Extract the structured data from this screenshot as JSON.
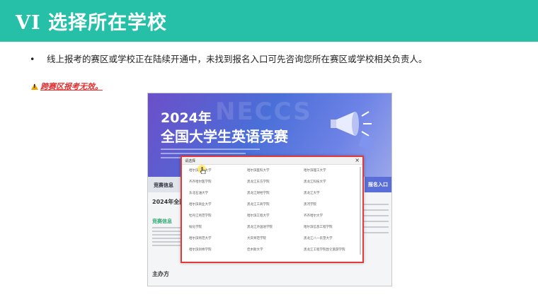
{
  "header": {
    "title": "VI 选择所在学校"
  },
  "bullet": {
    "dot": "•",
    "text": "线上报考的赛区或学校正在陆续开通中，未找到报名入口可先咨询您所在赛区或学校相关负责人。"
  },
  "warning": {
    "text": "跨赛区报考无效。"
  },
  "screenshot": {
    "watermark": "NECCS",
    "year": "2024年",
    "contest_name": "全国大学生英语竞赛",
    "nav_left": "竞赛信息",
    "nav_right": "报名入口",
    "section_title": "2024年全国",
    "section_info": "竞赛信息",
    "section_org": "主办方",
    "dialog": {
      "title": "请选择",
      "close": "×",
      "rows": [
        [
          "哈尔滨工业大学",
          "哈尔滨医科大学",
          "哈尔滨理工大学"
        ],
        [
          "齐齐哈尔医学院",
          "黑龙江东方学院",
          "黑龙江科技大学"
        ],
        [
          "东北石油大学",
          "黑龙江财经学院",
          "黑龙江大学"
        ],
        [
          "哈尔滨商业大学",
          "黑龙江工商学院",
          "黑河学院"
        ],
        [
          "牡丹江师范学院",
          "哈尔滨工程大学",
          "齐齐哈尔大学"
        ],
        [
          "绥化学院",
          "黑龙江外国语学院",
          "哈尔滨信息工程学院"
        ],
        [
          "哈尔滨师范大学",
          "大庆师范学院",
          "黑龙江八一农垦大学"
        ],
        [
          "哈尔滨剑桥学院",
          "佳木斯大学",
          "黑龙江工程学院昆仑旅游学院"
        ]
      ]
    }
  },
  "colors": {
    "banner": "#26c0a8",
    "warning": "#e03030",
    "dialog_border": "#e23a3a"
  }
}
